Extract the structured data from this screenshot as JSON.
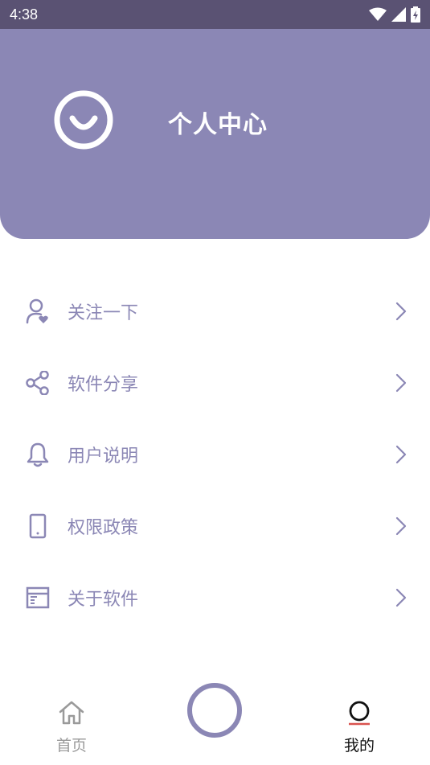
{
  "status_bar": {
    "time": "4:38"
  },
  "header": {
    "title": "个人中心"
  },
  "menu": {
    "items": [
      {
        "label": "关注一下",
        "icon": "user-heart-icon"
      },
      {
        "label": "软件分享",
        "icon": "share-icon"
      },
      {
        "label": "用户说明",
        "icon": "bell-icon"
      },
      {
        "label": "权限政策",
        "icon": "phone-icon"
      },
      {
        "label": "关于软件",
        "icon": "window-icon"
      }
    ]
  },
  "bottom_nav": {
    "home_label": "首页",
    "mine_label": "我的"
  },
  "colors": {
    "accent": "#8b87b5",
    "status_bar": "#5a5273",
    "active_underline": "#d9534f"
  }
}
